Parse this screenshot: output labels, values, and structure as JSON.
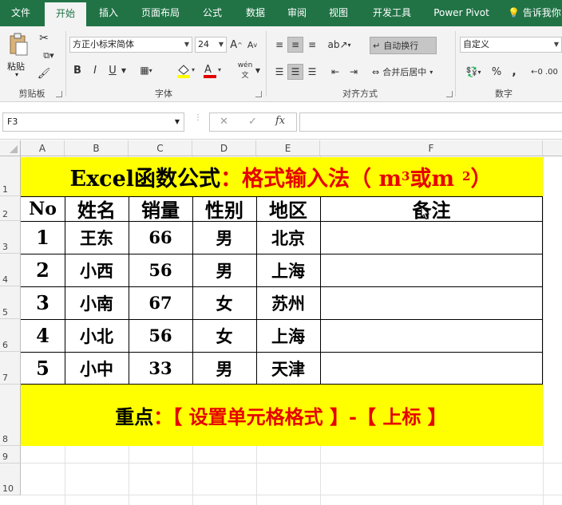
{
  "ribbon_tabs": [
    {
      "label": "文件"
    },
    {
      "label": "开始",
      "active": true
    },
    {
      "label": "插入"
    },
    {
      "label": "页面布局"
    },
    {
      "label": "公式"
    },
    {
      "label": "数据"
    },
    {
      "label": "审阅"
    },
    {
      "label": "视图"
    },
    {
      "label": "开发工具"
    },
    {
      "label": "Power Pivot"
    },
    {
      "label": "告诉我你"
    }
  ],
  "ribbon": {
    "clipboard": {
      "paste_label": "粘贴",
      "group_label": "剪贴板"
    },
    "font": {
      "font_name": "方正小标宋简体",
      "font_size": "24",
      "bold": "B",
      "italic": "I",
      "underline": "U",
      "group_label": "字体",
      "phonetic": "wén",
      "grow": "A",
      "shrink": "A"
    },
    "alignment": {
      "wrap_text": "自动换行",
      "merge_center": "合并后居中",
      "group_label": "对齐方式"
    },
    "number": {
      "format": "自定义",
      "percent": "%",
      "comma": ",",
      "group_label": "数字"
    }
  },
  "formula_bar": {
    "name_box": "F3",
    "cancel": "✕",
    "confirm": "✓",
    "fx": "fx",
    "content": ""
  },
  "columns": [
    "A",
    "B",
    "C",
    "D",
    "E",
    "F"
  ],
  "rows": [
    "1",
    "2",
    "3",
    "4",
    "5",
    "6",
    "7",
    "8",
    "9",
    "10"
  ],
  "sheet": {
    "title_black": "Excel函数公式",
    "title_red": "：格式输入法（ m",
    "title_sup1": "3",
    "title_mid": "或m",
    "title_sup2": "2",
    "title_close": "）",
    "headers": [
      "No",
      "姓名",
      "销量",
      "性别",
      "地区",
      "备注"
    ],
    "data_rows": [
      [
        "1",
        "王东",
        "66",
        "男",
        "北京",
        ""
      ],
      [
        "2",
        "小西",
        "56",
        "男",
        "上海",
        ""
      ],
      [
        "3",
        "小南",
        "67",
        "女",
        "苏州",
        ""
      ],
      [
        "4",
        "小北",
        "56",
        "女",
        "上海",
        ""
      ],
      [
        "5",
        "小中",
        "33",
        "男",
        "天津",
        ""
      ]
    ],
    "bottom_black": "重点",
    "bottom_red": "：【 设置单元格格式 】-【 上标 】"
  },
  "colors": {
    "excel_green": "#217346",
    "highlight_yellow": "#ffff00",
    "title_red": "#e60000"
  }
}
